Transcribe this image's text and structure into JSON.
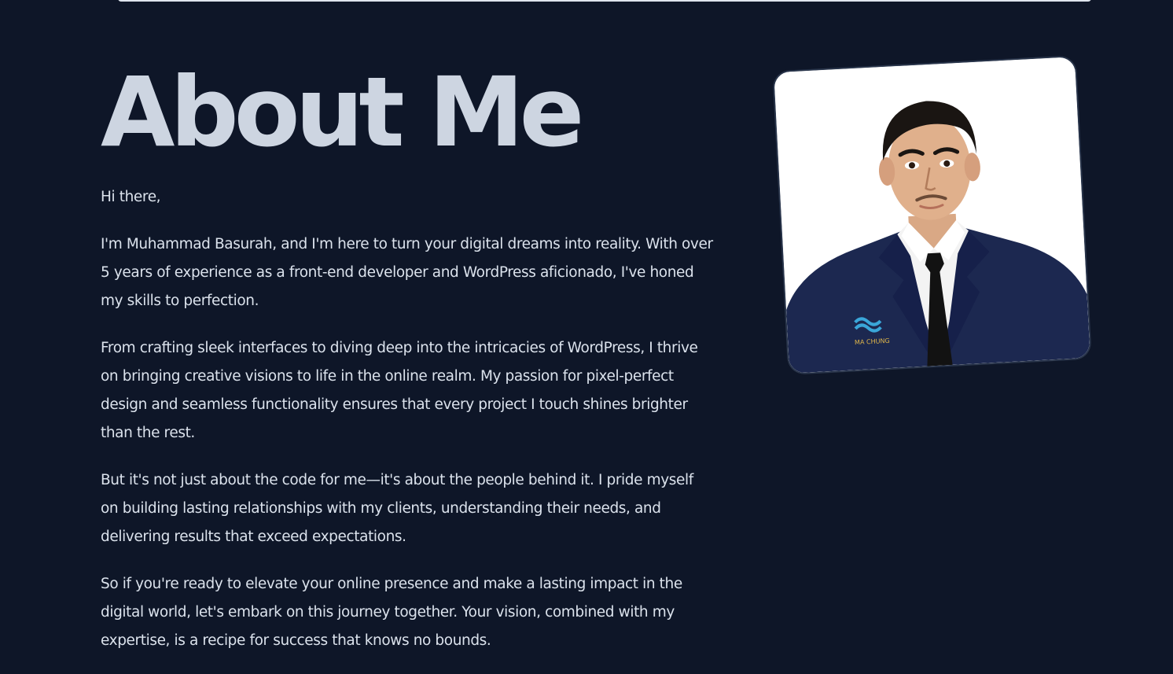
{
  "about": {
    "heading": "About Me",
    "greeting": "Hi there,",
    "paragraphs": [
      "I'm Muhammad Basurah, and I'm here to turn your digital dreams into reality. With over 5 years of experience as a front-end developer and WordPress aficionado, I've honed my skills to perfection.",
      "From crafting sleek interfaces to diving deep into the intricacies of WordPress, I thrive on bringing creative visions to life in the online realm. My passion for pixel-perfect design and seamless functionality ensures that every project I touch shines brighter than the rest.",
      "But it's not just about the code for me—it's about the people behind it. I pride myself on building lasting relationships with my clients, understanding their needs, and delivering results that exceed expectations.",
      "So if you're ready to elevate your online presence and make a lasting impact in the digital world, let's embark on this journey together. Your vision, combined with my expertise, is a recipe for success that knows no bounds."
    ]
  },
  "profile_photo": {
    "badge_text": "MA CHUNG"
  },
  "colors": {
    "background": "#0e1628",
    "heading": "#cdd5e1",
    "body_text": "#dbe2ec",
    "suit": "#1c2850"
  }
}
